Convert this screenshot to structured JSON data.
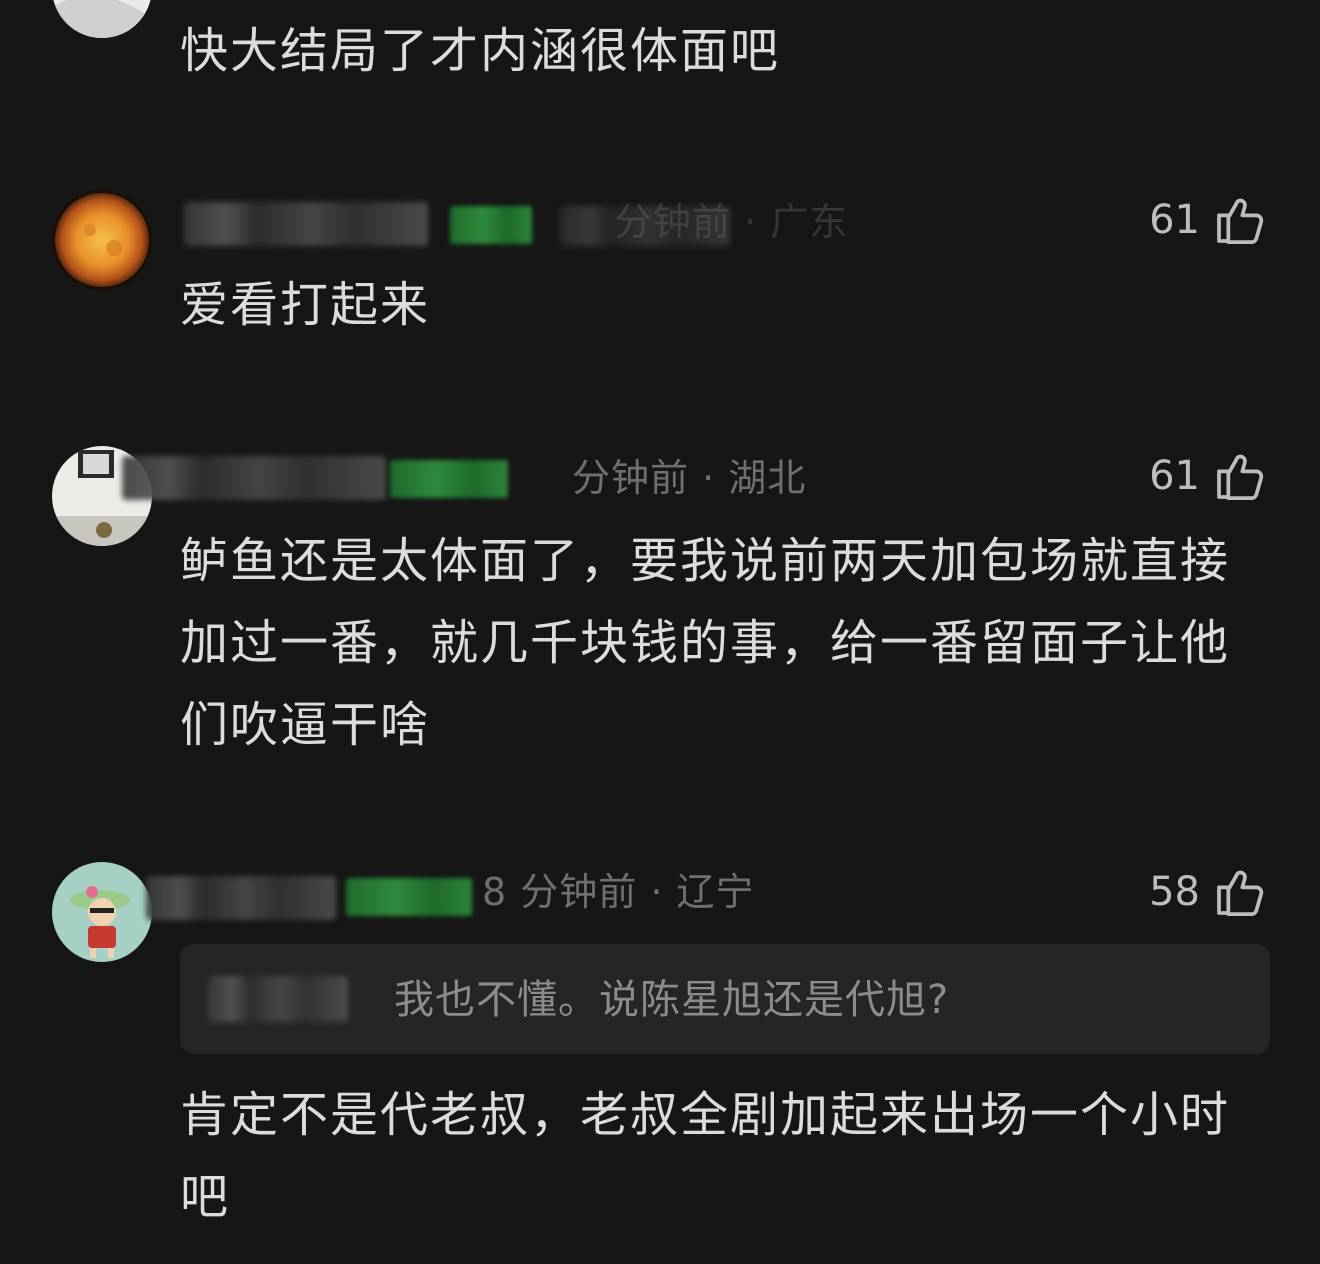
{
  "comments": [
    {
      "text": "快大结局了才内涵很体面吧"
    },
    {
      "meta": "分钟前 · 广东",
      "likes": "61",
      "text": "爱看打起来"
    },
    {
      "meta": "分钟前 · 湖北",
      "likes": "61",
      "text": "鲈鱼还是太体面了，要我说前两天加包场就直接加过一番，就几千块钱的事，给一番留面子让他们吹逼干啥"
    },
    {
      "meta": "8 分钟前 · 辽宁",
      "likes": "58",
      "quote": "我也不懂。说陈星旭还是代旭?",
      "text": "肯定不是代老叔，老叔全剧加起来出场一个小时吧"
    }
  ],
  "icons": {
    "like": "thumbs-up-icon"
  },
  "colors": {
    "background": "#161616",
    "text": "#dcdcdc",
    "meta": "#6f6f6f",
    "quote_bg": "#252525"
  }
}
